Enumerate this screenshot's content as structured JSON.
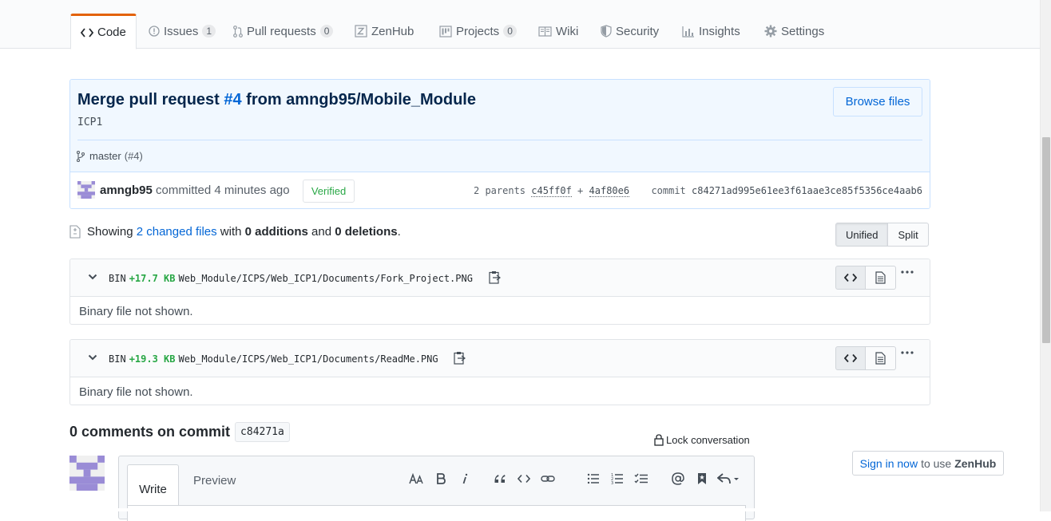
{
  "tabs": [
    {
      "label": "Code",
      "icon": "code-icon",
      "selected": true
    },
    {
      "label": "Issues",
      "icon": "issue-icon",
      "count": "1"
    },
    {
      "label": "Pull requests",
      "icon": "pull-request-icon",
      "count": "0"
    },
    {
      "label": "ZenHub",
      "icon": "zenhub-icon"
    },
    {
      "label": "Projects",
      "icon": "project-icon",
      "count": "0"
    },
    {
      "label": "Wiki",
      "icon": "book-icon"
    },
    {
      "label": "Security",
      "icon": "shield-icon"
    },
    {
      "label": "Insights",
      "icon": "graph-icon"
    },
    {
      "label": "Settings",
      "icon": "gear-icon"
    }
  ],
  "commit": {
    "title_prefix": "Merge pull request ",
    "pr_link": "#4",
    "title_suffix": " from amngb95/Mobile_Module",
    "description": "ICP1",
    "browse_files": "Browse files",
    "branch": "master",
    "branch_pr": "(#4)",
    "author": "amngb95",
    "committed_text": " committed 4 minutes ago",
    "verified": "Verified",
    "parents_label": "2 parents ",
    "parent1": "c45ff0f",
    "parents_plus": " + ",
    "parent2": "4af80e6",
    "commit_label": "commit ",
    "sha": "c84271ad995e61ee3f61aae3ce85f5356ce4aab6"
  },
  "summary": {
    "showing": "Showing ",
    "changed_files": "2 changed files",
    "with": " with ",
    "additions": "0 additions",
    "and": " and ",
    "deletions": "0 deletions",
    "period": ".",
    "unified": "Unified",
    "split": "Split"
  },
  "files": [
    {
      "type": "BIN",
      "size": "+17.7 KB",
      "path": "Web_Module/ICPS/Web_ICP1/Documents/Fork_Project.PNG",
      "body": "Binary file not shown."
    },
    {
      "type": "BIN",
      "size": "+19.3 KB",
      "path": "Web_Module/ICPS/Web_ICP1/Documents/ReadMe.PNG",
      "body": "Binary file not shown."
    }
  ],
  "comments": {
    "title": "0 comments on commit",
    "sha_short": "c84271a",
    "lock": "Lock conversation",
    "write_tab": "Write",
    "preview_tab": "Preview"
  },
  "zenhub": {
    "sign_in": "Sign in now",
    "to_use": " to use",
    "brand": "ZenHub"
  },
  "colors": {
    "link": "#0366d6",
    "added": "#28a745",
    "tab_accent": "#e36209",
    "commit_bg": "#f1f8ff"
  }
}
